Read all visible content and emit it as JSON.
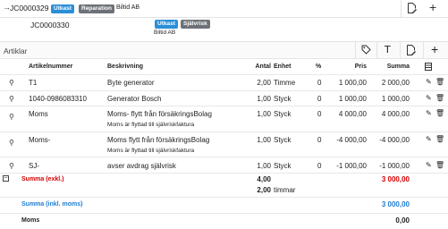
{
  "header": {
    "job_id": "JC0000329",
    "status_badge": "Utkast",
    "type_badge": "Reparation",
    "company": "Biltid AB"
  },
  "subheader": {
    "job_id": "JC0000330",
    "status_badge": "Utkast",
    "type_badge": "Självrisk",
    "company": "Biltid AB"
  },
  "section": {
    "title": "Artiklar"
  },
  "columns": {
    "article": "Artikelnummer",
    "description": "Beskrivning",
    "quantity": "Antal",
    "unit": "Enhet",
    "percent": "%",
    "price": "Pris",
    "sum": "Summa"
  },
  "rows": [
    {
      "article": "T1",
      "description": "Byte generator",
      "note": "",
      "quantity": "2,00",
      "unit": "Timme",
      "percent": "0",
      "price": "1 000,00",
      "sum": "2 000,00"
    },
    {
      "article": "1040-0986083310",
      "description": "Generator Bosch",
      "note": "",
      "quantity": "1,00",
      "unit": "Styck",
      "percent": "0",
      "price": "1 000,00",
      "sum": "1 000,00"
    },
    {
      "article": "Moms",
      "description": "Moms- flytt från försäkringsBolag",
      "note": "Moms är flyttad till självriskfaktura",
      "quantity": "1,00",
      "unit": "Styck",
      "percent": "0",
      "price": "4 000,00",
      "sum": "4 000,00"
    },
    {
      "article": "Moms-",
      "description": "Moms flytt från försäkringsBolag",
      "note": "Moms är flyttad till självriskfaktura",
      "quantity": "1,00",
      "unit": "Styck",
      "percent": "0",
      "price": "-4 000,00",
      "sum": "-4 000,00"
    },
    {
      "article": "SJ-",
      "description": "avser avdrag självrisk",
      "note": "",
      "quantity": "1,00",
      "unit": "Styck",
      "percent": "0",
      "price": "-1 000,00",
      "sum": "-1 000,00"
    }
  ],
  "totals": {
    "excl_label": "Summa (exkl.)",
    "qty_total": "4,00",
    "hours_total": "2,00",
    "hours_unit": "timmar",
    "excl_value": "3 000,00",
    "incl_label": "Summa (inkl. moms)",
    "incl_value": "3 000,00",
    "vat_label": "Moms",
    "vat_value": "0,00"
  },
  "colors": {
    "accent_blue": "#1f7cd0",
    "badge_blue": "#2b8fd8",
    "badge_grey": "#6d7178",
    "negative_red": "#d40000"
  }
}
